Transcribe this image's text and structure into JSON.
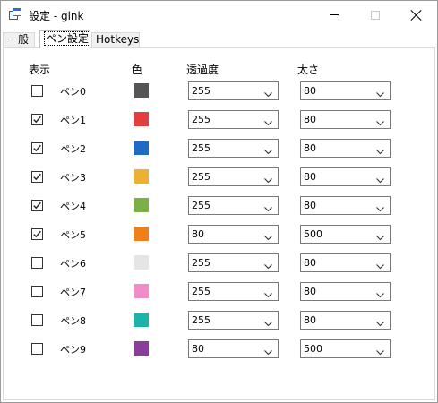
{
  "window": {
    "title": "設定 - glnk",
    "icon": "app-icon"
  },
  "tabs": [
    {
      "label": "一般"
    },
    {
      "label": "ペン設定"
    },
    {
      "label": "Hotkeys"
    }
  ],
  "headers": {
    "visible": "表示",
    "color": "色",
    "opacity": "透過度",
    "width": "太さ"
  },
  "pens": [
    {
      "label": "ペン0",
      "checked": false,
      "color": "#555555",
      "opacity": "255",
      "width": "80"
    },
    {
      "label": "ペン1",
      "checked": true,
      "color": "#e33e3e",
      "opacity": "255",
      "width": "80"
    },
    {
      "label": "ペン2",
      "checked": true,
      "color": "#1e6ac5",
      "opacity": "255",
      "width": "80"
    },
    {
      "label": "ペン3",
      "checked": true,
      "color": "#ebb133",
      "opacity": "255",
      "width": "80"
    },
    {
      "label": "ペン4",
      "checked": true,
      "color": "#7cb046",
      "opacity": "255",
      "width": "80"
    },
    {
      "label": "ペン5",
      "checked": true,
      "color": "#ee7f1a",
      "opacity": "80",
      "width": "500"
    },
    {
      "label": "ペン6",
      "checked": false,
      "color": "#e5e5e5",
      "opacity": "255",
      "width": "80"
    },
    {
      "label": "ペン7",
      "checked": false,
      "color": "#f08cc6",
      "opacity": "255",
      "width": "80"
    },
    {
      "label": "ペン8",
      "checked": false,
      "color": "#1eb2ad",
      "opacity": "255",
      "width": "80"
    },
    {
      "label": "ペン9",
      "checked": false,
      "color": "#8a3e9a",
      "opacity": "80",
      "width": "500"
    }
  ]
}
